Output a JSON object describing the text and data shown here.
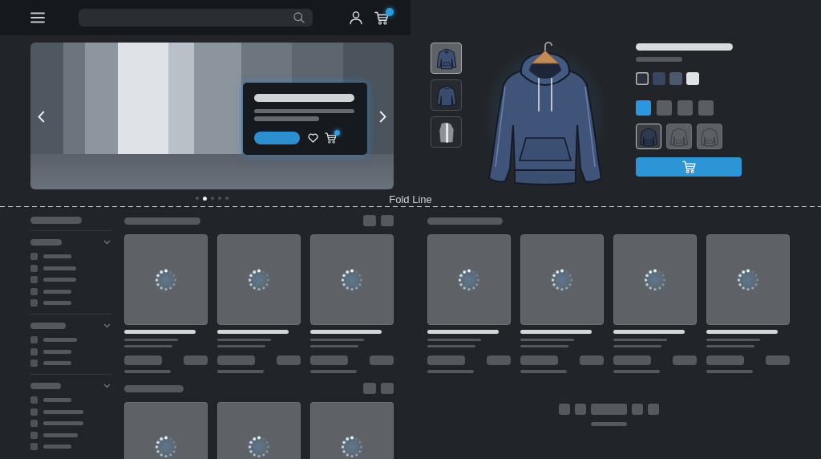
{
  "header": {
    "cart": {
      "badge": true
    }
  },
  "hero": {
    "slides": [
      {
        "selected": false
      },
      {
        "selected": true
      },
      {
        "selected": false
      },
      {
        "selected": false
      },
      {
        "selected": false
      }
    ],
    "promo_card": {
      "cart": {
        "badge": true
      }
    }
  },
  "gallery": {
    "thumbnails": [
      {
        "kind": "front",
        "selected": true
      },
      {
        "kind": "back",
        "selected": false
      },
      {
        "kind": "detail",
        "selected": false
      }
    ]
  },
  "product": {
    "colors": [
      {
        "color": "#2b303b",
        "selected": true
      },
      {
        "color": "#3a4562",
        "selected": false
      },
      {
        "color": "#4e586d",
        "selected": false
      },
      {
        "color": "#dfe2e6",
        "selected": false
      }
    ],
    "sizes": [
      {
        "selected": true
      },
      {
        "selected": false
      },
      {
        "selected": false
      },
      {
        "selected": false
      }
    ],
    "styles": [
      {
        "kind": "solid",
        "selected": true
      },
      {
        "kind": "outline",
        "selected": false
      },
      {
        "kind": "outline",
        "selected": false
      }
    ]
  },
  "fold_line": {
    "label": "Fold Line"
  },
  "filters": {
    "groups": [
      {
        "expanded": true,
        "options": [
          {
            "checked": false
          },
          {
            "checked": false
          },
          {
            "checked": false
          },
          {
            "checked": false
          },
          {
            "checked": false
          }
        ]
      },
      {
        "expanded": true,
        "options": [
          {
            "checked": false
          },
          {
            "checked": false
          },
          {
            "checked": false
          }
        ]
      },
      {
        "expanded": true,
        "options": [
          {
            "checked": false
          },
          {
            "checked": false
          },
          {
            "checked": false
          },
          {
            "checked": false
          },
          {
            "checked": false
          }
        ]
      }
    ]
  },
  "catalog": {
    "sections": [
      {
        "products": [
          {
            "loading": true
          },
          {
            "loading": true
          },
          {
            "loading": true
          }
        ]
      },
      {
        "products": [
          {
            "loading": true
          },
          {
            "loading": true
          },
          {
            "loading": true
          }
        ]
      }
    ]
  },
  "recommendations": {
    "products": [
      {
        "loading": true
      },
      {
        "loading": true
      },
      {
        "loading": true
      },
      {
        "loading": true
      }
    ]
  }
}
